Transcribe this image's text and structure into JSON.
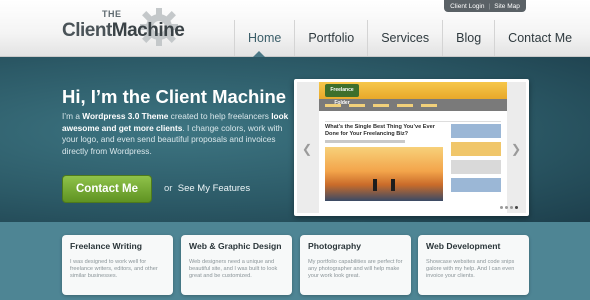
{
  "colors": {
    "accent_green": "#6ba82a",
    "hero_bg": "#2c5a67",
    "body_bg": "#4d8291"
  },
  "logo": {
    "top_word": "THE",
    "brand_first": "Client",
    "brand_second": "Machine",
    "icon": "gear-icon"
  },
  "toplinks": {
    "login": "Client Login",
    "sep": "|",
    "sitemap": "Site Map"
  },
  "nav": {
    "items": [
      "Home",
      "Portfolio",
      "Services",
      "Blog",
      "Contact Me"
    ],
    "active_index": 0
  },
  "hero": {
    "title": "Hi, I’m the Client Machine",
    "text_1": "I’m a ",
    "text_strong_1": "Wordpress 3.0 Theme",
    "text_2": " created to help freelancers ",
    "text_strong_2": "look awesome and get more clients",
    "text_3": ". I change colors, work with your logo, and even send beautiful proposals and invoices directly from Wordpress.",
    "cta_label": "Contact Me",
    "alt_prefix": "or",
    "alt_link": "See My Features"
  },
  "slider": {
    "prev_icon": "chevron-left-icon",
    "next_icon": "chevron-right-icon",
    "mock_logo": "Freelance Folder",
    "mock_heading": "What’s the Single Best Thing You’ve Ever Done for Your Freelancing Biz?",
    "prev_glyph": "❮",
    "next_glyph": "❯"
  },
  "features": [
    {
      "title": "Freelance Writing",
      "text": "I was designed to work well for freelance writers, editors, and other similar businesses."
    },
    {
      "title": "Web & Graphic Design",
      "text": "Web designers need a unique and beautiful site, and I was built to look great and be customized."
    },
    {
      "title": "Photography",
      "text": "My portfolio capabilities are perfect for any photographer and will help make your work look great."
    },
    {
      "title": "Web Development",
      "text": "Showcase websites and code snips galore with my help. And I can even invoice your clients."
    }
  ]
}
